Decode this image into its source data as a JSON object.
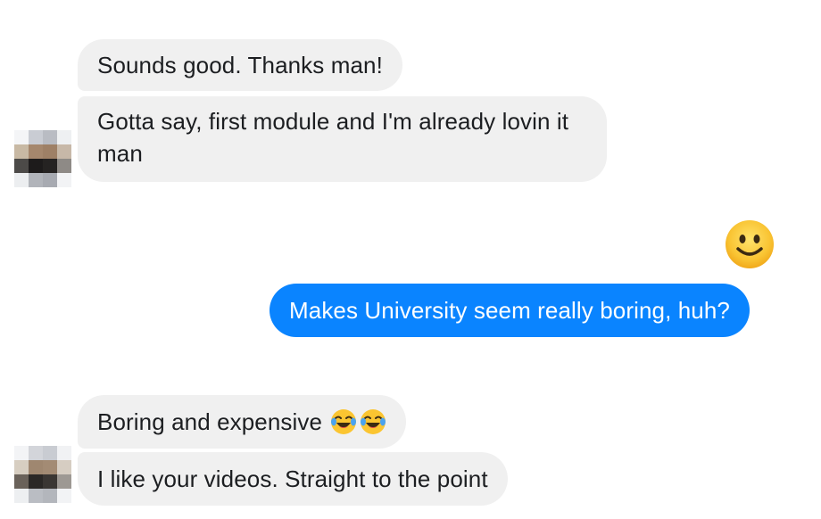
{
  "messages": [
    {
      "id": "m1",
      "sender": "them",
      "text": "Sounds good. Thanks man!"
    },
    {
      "id": "m2",
      "sender": "them",
      "text": "Gotta say, first module and I'm already lovin it man"
    },
    {
      "id": "e1",
      "sender": "me",
      "emoji": "slightly-smiling-face-icon"
    },
    {
      "id": "m3",
      "sender": "me",
      "text": "Makes University seem really boring, huh?"
    },
    {
      "id": "m4",
      "sender": "them",
      "text": "Boring and expensive",
      "emoji": [
        "tears-of-joy-icon",
        "tears-of-joy-icon"
      ]
    },
    {
      "id": "m5",
      "sender": "them",
      "text": "I like your videos. Straight to the point"
    }
  ],
  "colors": {
    "incoming_bubble": "#f0f0f0",
    "outgoing_bubble": "#0a84ff",
    "incoming_text": "#1c1e21",
    "outgoing_text": "#ffffff"
  }
}
